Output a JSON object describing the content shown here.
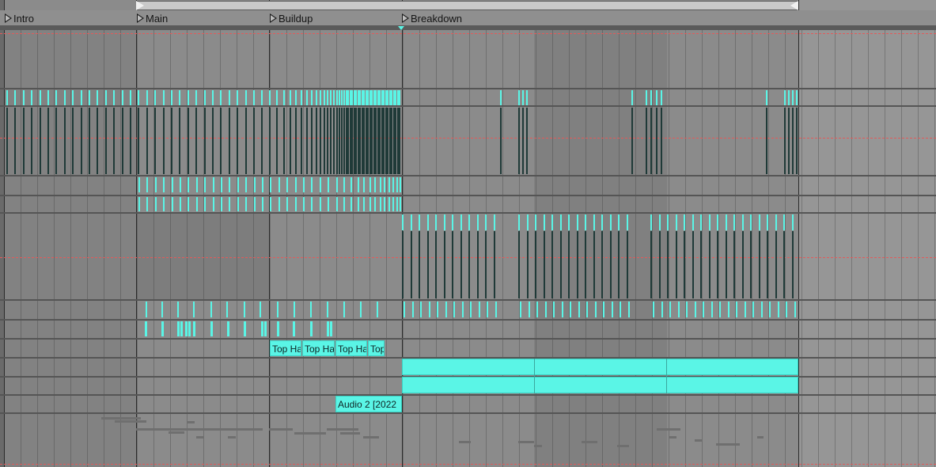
{
  "locators": [
    {
      "id": "intro",
      "label": "Intro"
    },
    {
      "id": "main",
      "label": "Main"
    },
    {
      "id": "buildup",
      "label": "Buildup"
    },
    {
      "id": "breakdown",
      "label": "Breakdown"
    }
  ],
  "clips": {
    "top_hat_1": "Top Hat",
    "top_hat_2": "Top Hat",
    "top_hat_3": "Top Hat",
    "top_hat_4": "Top",
    "audio_2": "Audio 2 [2022"
  },
  "colors": {
    "clip": "#5af5e6",
    "clip_dark": "#1f3a38",
    "background": "#8b8b8b",
    "shaded": "#7e7e7e",
    "loop_bar": "#c8c8c8",
    "dashed": "#e25a5a"
  }
}
